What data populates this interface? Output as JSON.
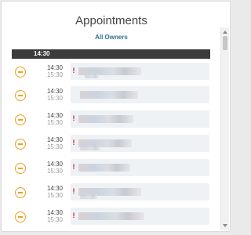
{
  "header": {
    "title": "Appointments",
    "owners_link": "All Owners"
  },
  "group": {
    "time_label": "14:30"
  },
  "appointments": [
    {
      "start": "14:30",
      "end": "15:30",
      "flag": "!"
    },
    {
      "start": "14:30",
      "end": "15:30",
      "flag": ""
    },
    {
      "start": "14:30",
      "end": "15:30",
      "flag": "!"
    },
    {
      "start": "14:30",
      "end": "15:30",
      "flag": "!"
    },
    {
      "start": "14:30",
      "end": "15:30",
      "flag": "!"
    },
    {
      "start": "14:30",
      "end": "15:30",
      "flag": "!"
    },
    {
      "start": "14:30",
      "end": "15:30",
      "flag": "!"
    }
  ],
  "colors": {
    "accent": "#f0a020",
    "flag": "#d21c1c",
    "link": "#2f6f93",
    "header_bar": "#3c3c3c"
  }
}
